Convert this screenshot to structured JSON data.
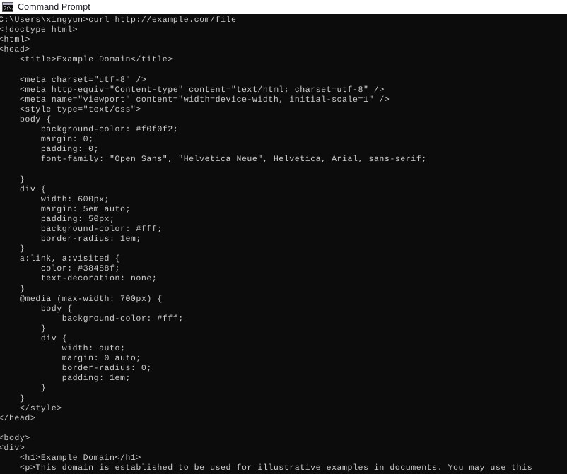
{
  "window": {
    "title": "Command Prompt",
    "icon": "command-prompt-icon",
    "background_color": "#0c0c0c",
    "text_color": "#cccccc",
    "titlebar_background_color": "#ffffff",
    "titlebar_text_color": "#16161d"
  },
  "terminal": {
    "prompt": "C:\\Users\\xingyun>",
    "command": "curl http://example.com/file",
    "prompt_line": "C:\\Users\\xingyun>curl http://example.com/file",
    "lines": [
      "C:\\Users\\xingyun>curl http://example.com/file",
      "<!doctype html>",
      "<html>",
      "<head>",
      "    <title>Example Domain</title>",
      "",
      "    <meta charset=\"utf-8\" />",
      "    <meta http-equiv=\"Content-type\" content=\"text/html; charset=utf-8\" />",
      "    <meta name=\"viewport\" content=\"width=device-width, initial-scale=1\" />",
      "    <style type=\"text/css\">",
      "    body {",
      "        background-color: #f0f0f2;",
      "        margin: 0;",
      "        padding: 0;",
      "        font-family: \"Open Sans\", \"Helvetica Neue\", Helvetica, Arial, sans-serif;",
      "        ",
      "    }",
      "    div {",
      "        width: 600px;",
      "        margin: 5em auto;",
      "        padding: 50px;",
      "        background-color: #fff;",
      "        border-radius: 1em;",
      "    }",
      "    a:link, a:visited {",
      "        color: #38488f;",
      "        text-decoration: none;",
      "    }",
      "    @media (max-width: 700px) {",
      "        body {",
      "            background-color: #fff;",
      "        }",
      "        div {",
      "            width: auto;",
      "            margin: 0 auto;",
      "            border-radius: 0;",
      "            padding: 1em;",
      "        }",
      "    }",
      "    </style>",
      "</head>",
      "",
      "<body>",
      "<div>",
      "    <h1>Example Domain</h1>",
      "    <p>This domain is established to be used for illustrative examples in documents. You may use this"
    ]
  }
}
